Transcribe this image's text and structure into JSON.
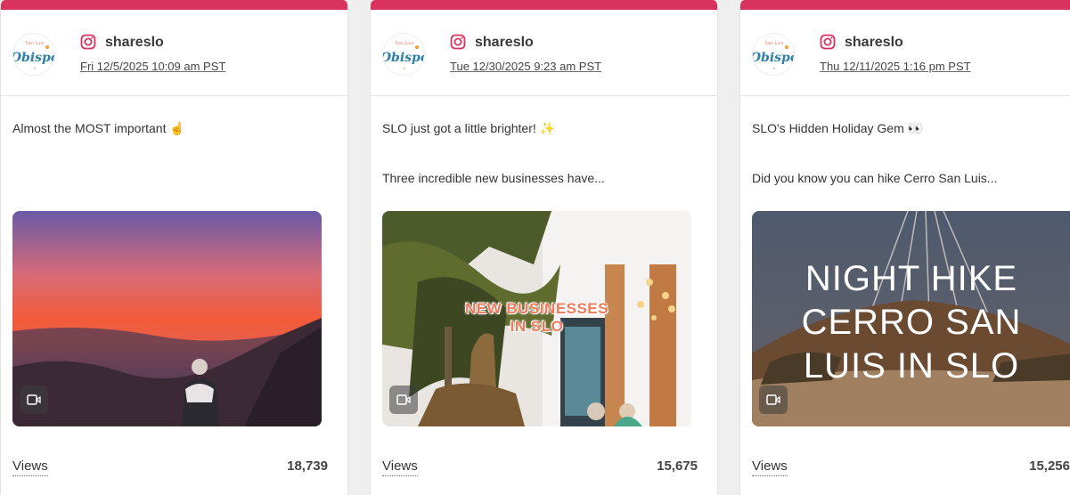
{
  "posts": [
    {
      "platform_icon": "instagram-icon",
      "handle": "shareslo",
      "date": "Fri 12/5/2025 10:09 am PST",
      "caption_line1": "Almost the MOST important ☝️",
      "caption_line2": "",
      "media_type_icon": "video-icon",
      "metric_label": "Views",
      "metric_value": "18,739"
    },
    {
      "platform_icon": "instagram-icon",
      "handle": "shareslo",
      "date": "Tue 12/30/2025 9:23 am PST",
      "caption_line1": "SLO just got a little brighter! ✨",
      "caption_line2": "Three incredible new businesses have...",
      "media_overlay": [
        "NEW BUSINESSES",
        "IN SLO"
      ],
      "media_type_icon": "video-icon",
      "metric_label": "Views",
      "metric_value": "15,675"
    },
    {
      "platform_icon": "instagram-icon",
      "handle": "shareslo",
      "date": "Thu 12/11/2025 1:16 pm PST",
      "caption_line1": "SLO's Hidden Holiday Gem 👀",
      "caption_line2": "Did you know you can hike Cerro San Luis...",
      "media_overlay": [
        "NIGHT HIKE",
        "CERRO SAN",
        "LUIS IN SLO"
      ],
      "media_type_icon": "video-icon",
      "metric_label": "Views",
      "metric_value": "15,256"
    }
  ],
  "avatar_text": [
    "Obispo"
  ],
  "colors": {
    "accent_bar": "#d8325e",
    "instagram": "#d8325e",
    "page_bg": "#efefef"
  }
}
